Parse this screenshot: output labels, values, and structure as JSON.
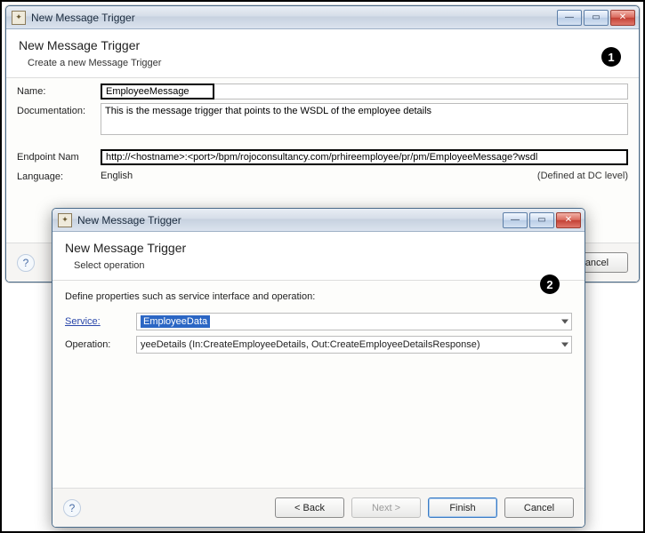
{
  "win1": {
    "title": "New Message Trigger",
    "header": "New Message Trigger",
    "subheader": "Create a new Message Trigger",
    "callout": "1",
    "labels": {
      "name": "Name:",
      "documentation": "Documentation:",
      "endpoint": "Endpoint Nam",
      "language": "Language:"
    },
    "values": {
      "name": "EmployeeMessage",
      "documentation": "This is the message trigger that points to the WSDL of the employee details",
      "endpoint": "http://<hostname>:<port>/bpm/rojoconsultancy.com/prhireemployee/pr/pm/EmployeeMessage?wsdl",
      "language": "English",
      "defined_at": "(Defined at DC level)"
    },
    "buttons": {
      "cancel": "Cancel"
    }
  },
  "win2": {
    "title": "New Message Trigger",
    "header": "New Message Trigger",
    "subheader": "Select operation",
    "callout": "2",
    "desc": "Define properties such as service interface and operation:",
    "labels": {
      "service": "Service:",
      "operation": "Operation:"
    },
    "values": {
      "service": "EmployeeData",
      "operation": "yeeDetails (In:CreateEmployeeDetails, Out:CreateEmployeeDetailsResponse)"
    },
    "buttons": {
      "back": "< Back",
      "next": "Next >",
      "finish": "Finish",
      "cancel": "Cancel"
    }
  },
  "win_controls": {
    "min": "—",
    "max": "▭",
    "close": "✕"
  }
}
